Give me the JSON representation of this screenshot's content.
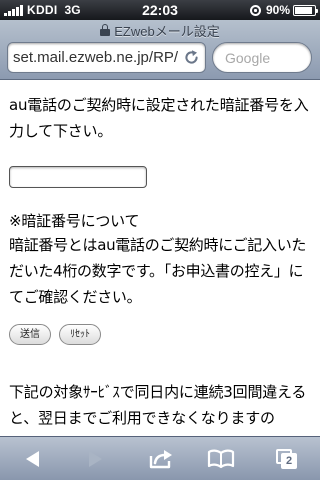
{
  "status_bar": {
    "carrier": "KDDI",
    "network": "3G",
    "time": "22:03",
    "battery_text": "90%",
    "battery_level": 0.9
  },
  "browser": {
    "page_title": "EZwebメール設定",
    "url": "set.mail.ezweb.ne.jp/RP/",
    "search_placeholder": "Google",
    "tab_count": "2"
  },
  "form": {
    "intro": "au電話のご契約時に設定された暗証番号を入力して下さい。",
    "pin_value": "",
    "about_heading": "※暗証番号について",
    "about_body": "暗証番号とはau電話のご契約時にご記入いただいた4桁の数字です。「お申込書の控え」にてご確認ください。",
    "submit_label": "送信",
    "reset_label": "ﾘｾｯﾄ",
    "notice": "下記の対象ｻｰﾋﾞｽで同日内に連続3回間違えると、翌日までご利用できなくなりますの"
  },
  "colors": {
    "toolbar_gradient_top": "#b8c2d0",
    "toolbar_gradient_bottom": "#8997ad",
    "status_bar": "#16181c"
  },
  "icons": {
    "back": "back-arrow-icon",
    "forward": "forward-arrow-icon",
    "share": "share-icon",
    "bookmarks": "bookmarks-icon",
    "pages": "pages-icon",
    "reload": "reload-icon",
    "padlock": "padlock-icon"
  }
}
